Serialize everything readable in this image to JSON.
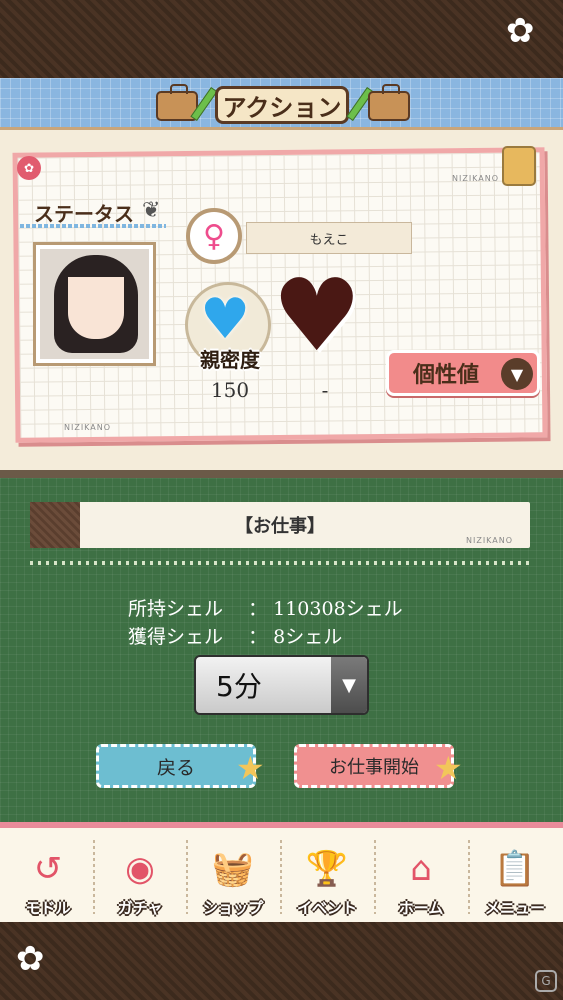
{
  "header": {
    "title": "アクション"
  },
  "status": {
    "title": "ステータス",
    "name": "もえこ",
    "intimacy_label": "親密度",
    "intimacy_value": "150",
    "second_value": "-",
    "personality_label": "個性値",
    "watermark_text": "NIZIKANO"
  },
  "job": {
    "banner_title": "【お仕事】",
    "owned_shells_label": "所持シェル",
    "owned_shells_value": "110308シェル",
    "earned_shells_label": "獲得シェル",
    "earned_shells_value": "8シェル",
    "duration_selected": "5分",
    "back_label": "戻る",
    "start_label": "お仕事開始"
  },
  "nav": {
    "items": [
      {
        "label": "モドル",
        "icon": "back-arrow-icon"
      },
      {
        "label": "ガチャ",
        "icon": "gacha-machine-icon"
      },
      {
        "label": "ショップ",
        "icon": "shop-basket-icon"
      },
      {
        "label": "イベント",
        "icon": "trophy-icon"
      },
      {
        "label": "ホーム",
        "icon": "home-icon"
      },
      {
        "label": "メニュー",
        "icon": "menu-clipboard-icon"
      }
    ]
  },
  "colors": {
    "accent_pink": "#f28b8b",
    "accent_blue": "#6dbed1",
    "board_green": "#3e7044",
    "wood_brown": "#4a3324"
  }
}
